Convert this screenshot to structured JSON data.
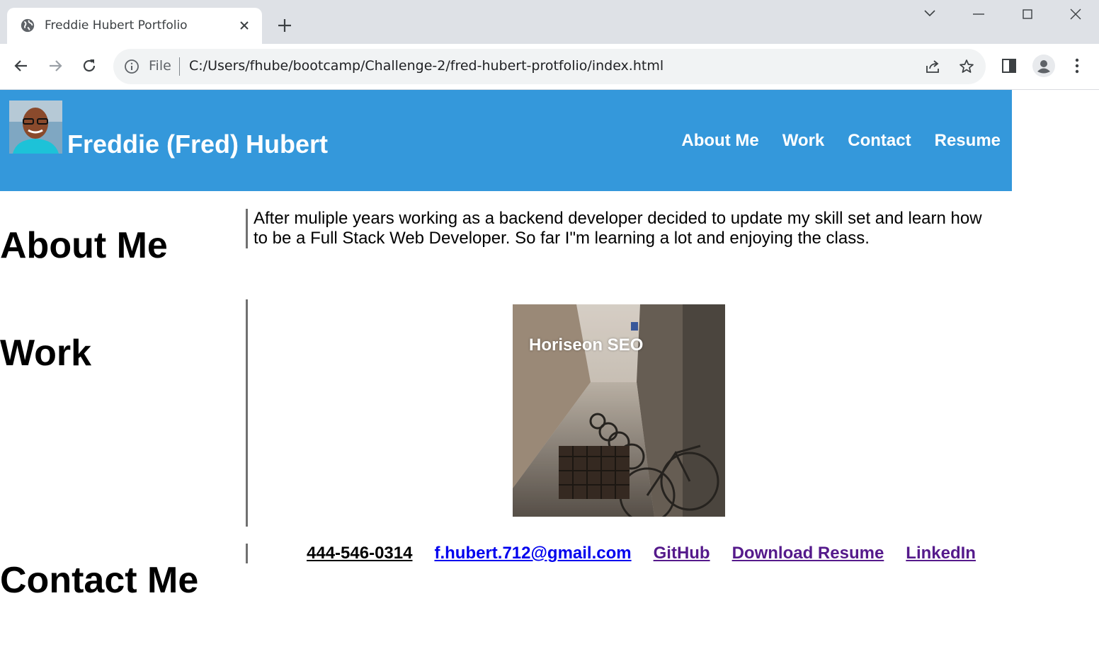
{
  "browser": {
    "tab_title": "Freddie Hubert Portfolio",
    "omnibox": {
      "scheme_label": "File",
      "url": "C:/Users/fhube/bootcamp/Challenge-2/fred-hubert-protfolio/index.html"
    },
    "icons": [
      "globe-icon",
      "close-icon",
      "plus-icon",
      "chevron-down-icon",
      "minimize-icon",
      "maximize-icon",
      "close-window-icon",
      "back-arrow-icon",
      "forward-arrow-icon",
      "reload-icon",
      "info-icon",
      "share-icon",
      "star-icon",
      "side-panel-icon",
      "profile-icon",
      "more-vert-icon"
    ]
  },
  "header": {
    "name": "Freddie (Fred) Hubert",
    "nav": [
      "About Me",
      "Work",
      "Contact",
      "Resume"
    ]
  },
  "about": {
    "title": "About Me",
    "text": "After muliple years working as a backend developer decided to update my skill set and learn how to be a Full Stack Web Developer. So far I\"m learning a lot and enjoying the class."
  },
  "work": {
    "title": "Work",
    "project_title": "Horiseon SEO"
  },
  "contact": {
    "title": "Contact Me",
    "phone": "444-546-0314",
    "email": "f.hubert.712@gmail.com",
    "github": "GitHub",
    "resume": "Download Resume",
    "linkedin": "LinkedIn"
  },
  "colors": {
    "header_bg": "#3498db",
    "link_visited": "#551a8b",
    "link_unvisited": "#0000ee",
    "phone_link": "#000000"
  }
}
